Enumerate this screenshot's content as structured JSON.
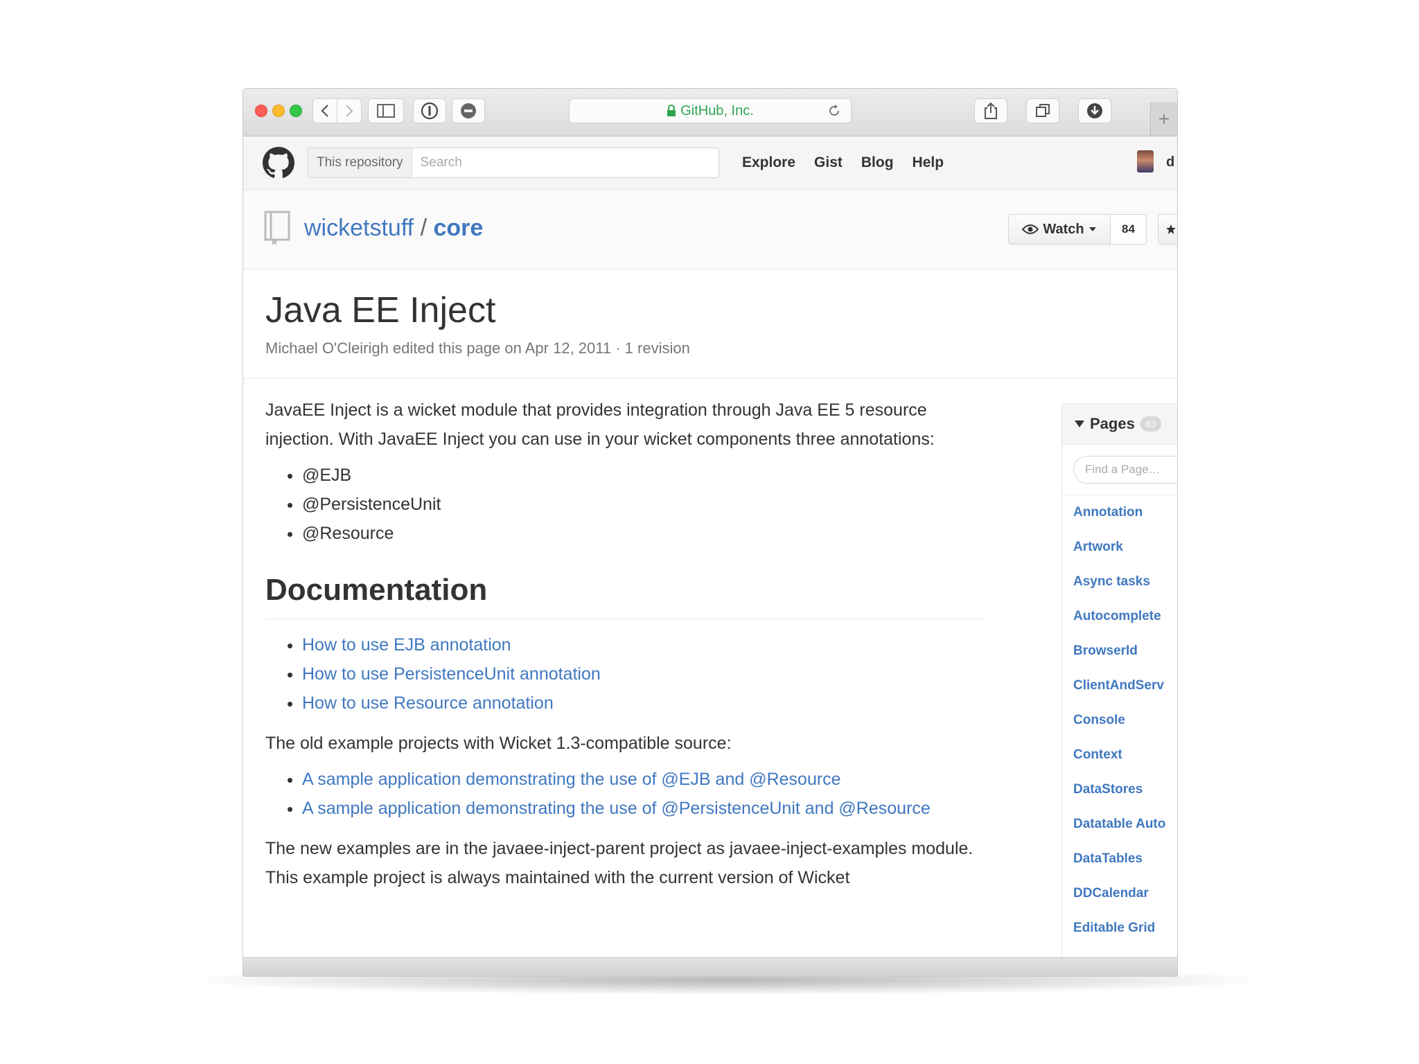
{
  "browser": {
    "address_text": "GitHub, Inc.",
    "new_tab_glyph": "+"
  },
  "header": {
    "search_scope": "This repository",
    "search_placeholder": "Search",
    "nav": [
      "Explore",
      "Gist",
      "Blog",
      "Help"
    ],
    "username_partial": "d"
  },
  "repo": {
    "owner": "wicketstuff",
    "separator": "/",
    "name": "core",
    "watch_label": "Watch",
    "watch_count": "84"
  },
  "page": {
    "title": "Java EE Inject",
    "meta": "Michael O'Cleirigh edited this page on Apr 12, 2011 · 1 revision",
    "intro": "JavaEE Inject is a wicket module that provides integration through Java EE 5 resource injection. With JavaEE Inject you can use in your wicket components three annotations:",
    "annotations": [
      "@EJB",
      "@PersistenceUnit",
      "@Resource"
    ],
    "doc_heading": "Documentation",
    "doc_links": [
      "How to use EJB annotation",
      "How to use PersistenceUnit annotation",
      "How to use Resource annotation"
    ],
    "old_examples_text": "The old example projects with Wicket 1.3-compatible source:",
    "sample_links": [
      "A sample application demonstrating the use of @EJB and @Resource",
      "A sample application demonstrating the use of @PersistenceUnit and @Resource"
    ],
    "new_examples_text": "The new examples are in the javaee-inject-parent project as javaee-inject-examples module. This example project is always maintained with the current version of Wicket"
  },
  "sidebar": {
    "heading": "Pages",
    "count": "83",
    "find_placeholder": "Find a Page…",
    "pages": [
      "Annotation",
      "Artwork",
      "Async tasks",
      "Autocomplete",
      "BrowserId",
      "ClientAndServ",
      "Console",
      "Context",
      "DataStores",
      "Datatable Auto",
      "DataTables",
      "DDCalendar",
      "Editable Grid"
    ]
  },
  "colors": {
    "link": "#4078c0",
    "secure_green": "#2ea44f",
    "close": "#fc5f57",
    "minimize": "#fdbc2e",
    "zoom": "#33c748"
  }
}
